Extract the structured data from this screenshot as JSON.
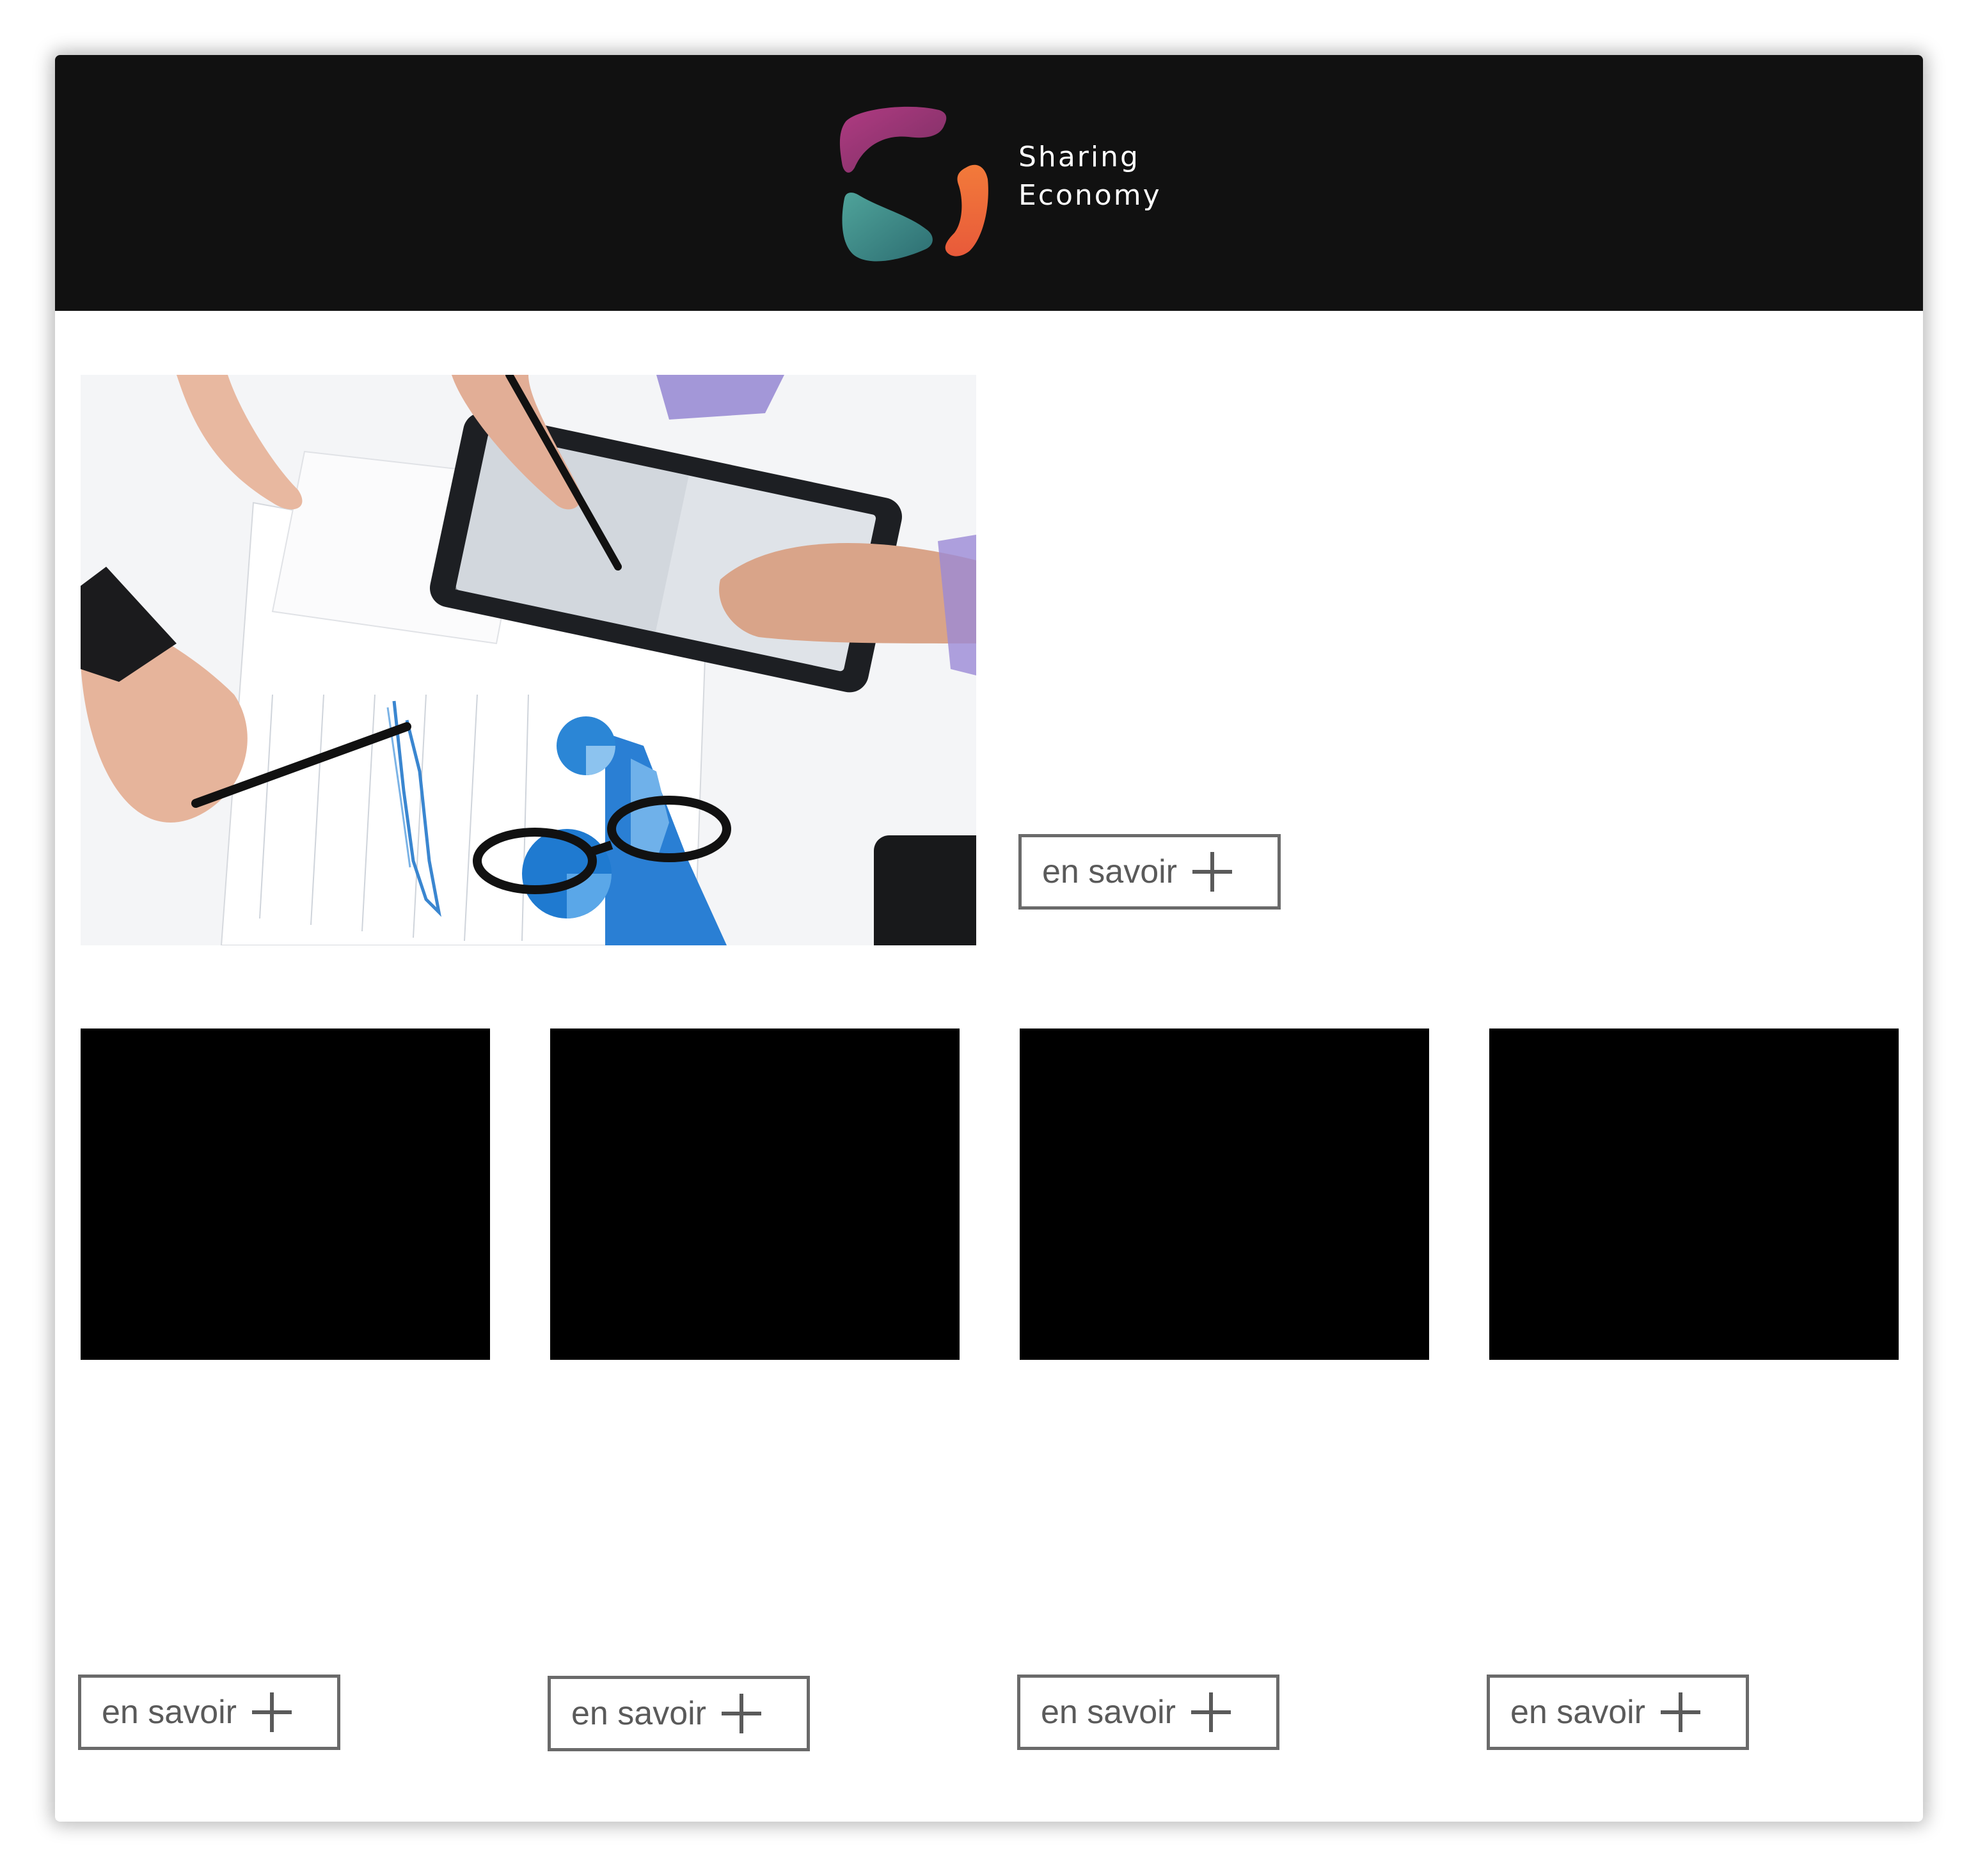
{
  "header": {
    "brand_line1": "Sharing",
    "brand_line2": "Economy",
    "logo_colors": {
      "purple": "#8e3a6b",
      "orange": "#ef6a3d",
      "teal": "#3e8b86"
    }
  },
  "hero": {
    "image": "business-meeting-tablet-charts-photo",
    "button_label": "en savoir",
    "button_icon": "plus-icon"
  },
  "cards": [
    {
      "image": "black-placeholder",
      "button_label": "en savoir",
      "button_icon": "plus-icon"
    },
    {
      "image": "black-placeholder",
      "button_label": "en savoir",
      "button_icon": "plus-icon"
    },
    {
      "image": "black-placeholder",
      "button_label": "en savoir",
      "button_icon": "plus-icon"
    },
    {
      "image": "black-placeholder",
      "button_label": "en savoir",
      "button_icon": "plus-icon"
    }
  ]
}
